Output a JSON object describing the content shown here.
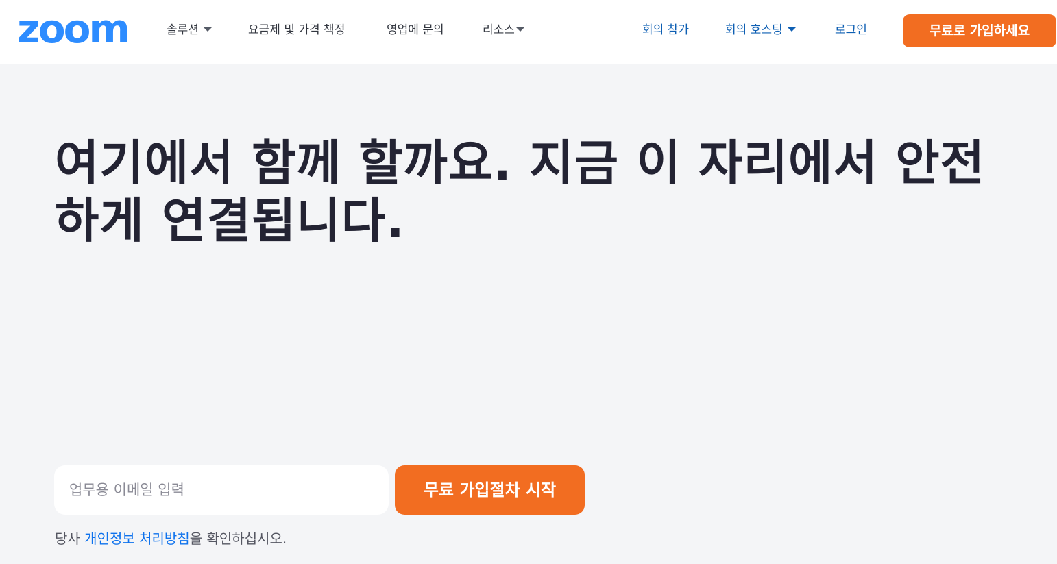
{
  "header": {
    "logo_text": "zoom",
    "nav_left": [
      {
        "label": "솔루션",
        "has_dropdown": true
      },
      {
        "label": "요금제 및 가격 책정",
        "has_dropdown": false
      },
      {
        "label": "영업에 문의",
        "has_dropdown": false
      },
      {
        "label": "리소스",
        "has_dropdown": true
      }
    ],
    "nav_right": [
      {
        "label": "회의 참가",
        "has_dropdown": false
      },
      {
        "label": "회의 호스팅",
        "has_dropdown": true
      },
      {
        "label": "로그인",
        "has_dropdown": false
      }
    ],
    "signup_label": "무료로 가입하세요"
  },
  "hero": {
    "title": "여기에서 함께 할까요. 지금 이 자리에서 안전하게 연결됩니다.",
    "email_placeholder": "업무용 이메일 입력",
    "email_value": "",
    "start_label": "무료 가입절차 시작",
    "privacy": {
      "prefix": "당사 ",
      "link": "개인정보 처리방침",
      "suffix": "을 확인하십시오."
    }
  },
  "colors": {
    "brand_blue": "#2d8cff",
    "accent_orange": "#f26d21",
    "link_blue": "#0e72ed",
    "nav_blue": "#0e5fb3",
    "page_background": "#f4f5f7"
  },
  "icons": [
    "zoom-logo",
    "caret-down-icon"
  ]
}
